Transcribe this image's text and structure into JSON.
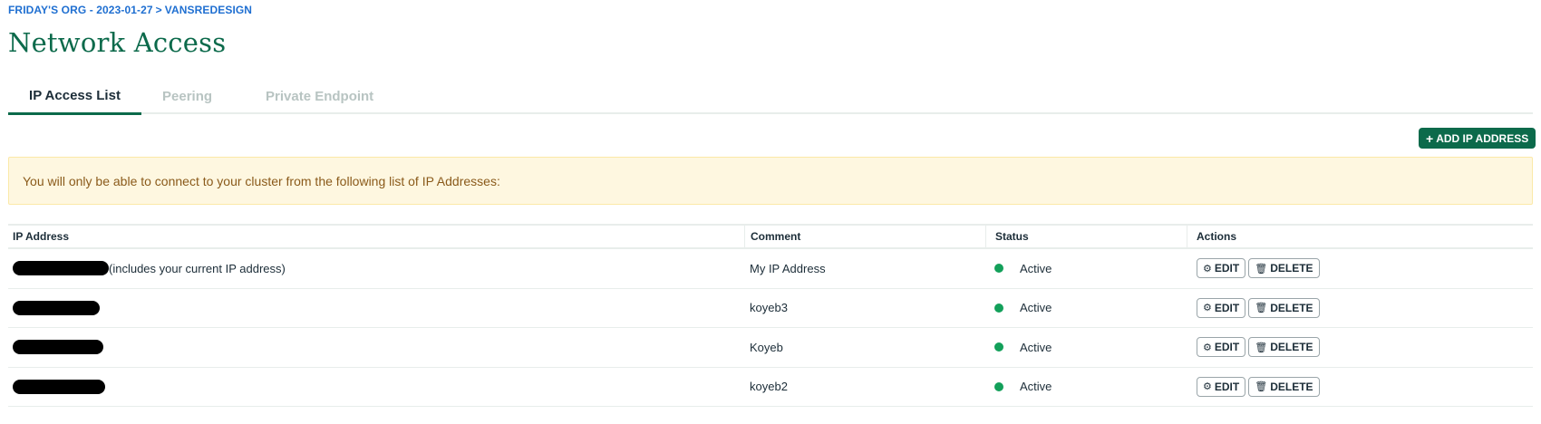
{
  "breadcrumb": {
    "org": "FRIDAY'S ORG - 2023-01-27",
    "separator": ">",
    "project": "VANSREDESIGN"
  },
  "page_title": "Network Access",
  "tabs": [
    {
      "label": "IP Access List",
      "active": true
    },
    {
      "label": "Peering",
      "active": false
    },
    {
      "label": "Private Endpoint",
      "active": false
    }
  ],
  "add_button": {
    "icon": "plus-icon",
    "label": "ADD IP ADDRESS"
  },
  "banner_text": "You will only be able to connect to your cluster from the following list of IP Addresses:",
  "table": {
    "headers": {
      "ip": "IP Address",
      "comment": "Comment",
      "status": "Status",
      "actions": "Actions"
    },
    "rows": [
      {
        "ip_note": "(includes your current IP address)",
        "comment": "My IP Address",
        "status": "Active"
      },
      {
        "ip_note": "",
        "comment": "koyeb3",
        "status": "Active"
      },
      {
        "ip_note": "",
        "comment": "Koyeb",
        "status": "Active"
      },
      {
        "ip_note": "",
        "comment": "koyeb2",
        "status": "Active"
      }
    ],
    "edit_label": "EDIT",
    "delete_label": "DELETE",
    "edit_icon": "gear-icon",
    "delete_icon": "trash-icon"
  },
  "colors": {
    "brand": "#0c6a4b",
    "breadcrumb_link": "#1f6fd1",
    "status_active": "#13a05a",
    "banner_bg": "#fef7e0",
    "banner_text": "#8a5a1a"
  }
}
